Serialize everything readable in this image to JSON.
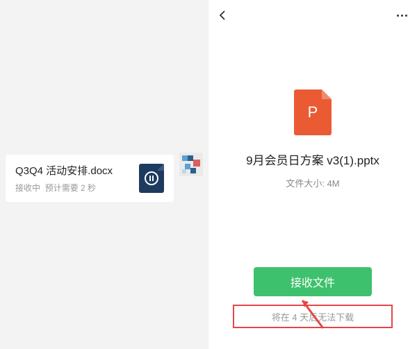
{
  "left_file": {
    "title": "Q3Q4 活动安排.docx",
    "status_receiving": "接收中",
    "status_eta": "预计需要 2 秒"
  },
  "right_file": {
    "icon_letter": "P",
    "title": "9月会员日方案 v3(1).pptx",
    "size_label": "文件大小: 4M"
  },
  "actions": {
    "receive_button": "接收文件",
    "expire_notice": "将在 4 天后无法下载"
  },
  "colors": {
    "ppt_orange": "#eb5b33",
    "doc_navy": "#1e3a5f",
    "button_green": "#3ec16c",
    "highlight_red": "#e64545"
  }
}
